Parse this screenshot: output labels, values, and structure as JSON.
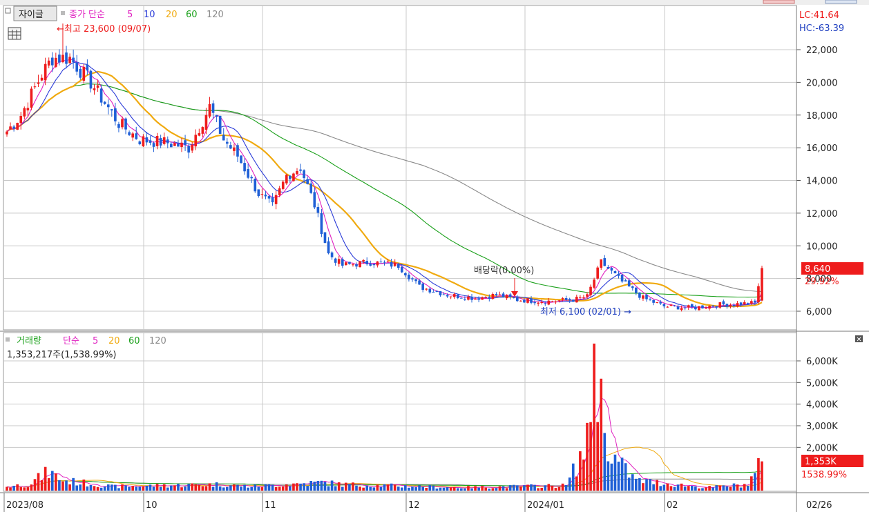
{
  "colors": {
    "up": "#ee1c1c",
    "down": "#1f5fd6",
    "ma5": "#e020c0",
    "ma10": "#2a3bd8",
    "ma20": "#f0aa10",
    "ma60": "#1aa01a",
    "ma120": "#8a8a8a",
    "grid": "#c8c8c8",
    "frame": "#9a9a9a",
    "text": "#222222"
  },
  "price_panel": {
    "button_label": "자이글",
    "legend": {
      "prefix": "종가 단순",
      "items": [
        {
          "label": "5",
          "color": "#e020c0"
        },
        {
          "label": "10",
          "color": "#2a3bd8"
        },
        {
          "label": "20",
          "color": "#f0aa10"
        },
        {
          "label": "60",
          "color": "#1aa01a"
        },
        {
          "label": "120",
          "color": "#8a8a8a"
        }
      ]
    },
    "high_marker": "←최고 23,600 (09/07)",
    "low_marker": "최저 6,100 (02/01) →",
    "dividend_marker": "배당락(0.00%)",
    "lc_text": "LC:41.64",
    "hc_text": "HC:-63.39",
    "last_price_tag": "8,640",
    "last_change_tag": "29.92%",
    "yticks": [
      "22,000",
      "20,000",
      "18,000",
      "16,000",
      "14,000",
      "12,000",
      "10,000",
      "8,000",
      "6,000"
    ],
    "icons": [
      "table-icon"
    ]
  },
  "volume_panel": {
    "legend": {
      "prefix": "거래량",
      "suffix": "단순",
      "items": [
        {
          "label": "5",
          "color": "#e020c0"
        },
        {
          "label": "20",
          "color": "#f0aa10"
        },
        {
          "label": "60",
          "color": "#1aa01a"
        },
        {
          "label": "120",
          "color": "#8a8a8a"
        }
      ]
    },
    "info_text": "1,353,217주(1,538.99%)",
    "last_volume_tag": "1,353K",
    "last_volume_pct_tag": "1538.99%",
    "yticks": [
      "6,000K",
      "5,000K",
      "4,000K",
      "3,000K",
      "2,000K"
    ],
    "icons": [
      "collapse-icon"
    ]
  },
  "xaxis": {
    "labels": [
      "2023/08",
      "10",
      "11",
      "12",
      "2024/01",
      "02",
      "02/26"
    ]
  },
  "chart_data": {
    "type": "candlestick",
    "x_range": [
      "2023/08",
      "2024/02/26"
    ],
    "price_ylim": [
      5000,
      24000
    ],
    "volume_ylim": [
      0,
      7000
    ],
    "x_tick_positions": [
      {
        "label": "2023/08",
        "index": 0
      },
      {
        "label": "10",
        "index": 40
      },
      {
        "label": "11",
        "index": 74
      },
      {
        "label": "12",
        "index": 115
      },
      {
        "label": "2024/01",
        "index": 149
      },
      {
        "label": "02",
        "index": 189
      }
    ],
    "high": {
      "price": 23600,
      "date": "09/07"
    },
    "low": {
      "price": 6100,
      "date": "02/01"
    },
    "last": {
      "price": 8640,
      "change_pct": 29.92,
      "volume_k": 1353
    },
    "anchors": [
      [
        0,
        17000
      ],
      [
        4,
        18000
      ],
      [
        10,
        20500
      ],
      [
        13,
        21500
      ],
      [
        18,
        21500
      ],
      [
        24,
        20000
      ],
      [
        32,
        17500
      ],
      [
        38,
        16500
      ],
      [
        46,
        16300
      ],
      [
        52,
        16000
      ],
      [
        58,
        18500
      ],
      [
        62,
        16500
      ],
      [
        66,
        15500
      ],
      [
        72,
        13200
      ],
      [
        76,
        12400
      ],
      [
        80,
        14300
      ],
      [
        84,
        14800
      ],
      [
        88,
        12500
      ],
      [
        92,
        9500
      ],
      [
        96,
        8800
      ],
      [
        104,
        9000
      ],
      [
        112,
        8800
      ],
      [
        118,
        7500
      ],
      [
        126,
        7000
      ],
      [
        134,
        6800
      ],
      [
        140,
        7000
      ],
      [
        146,
        6700
      ],
      [
        154,
        6600
      ],
      [
        162,
        6700
      ],
      [
        166,
        6900
      ],
      [
        170,
        9000
      ],
      [
        176,
        7800
      ],
      [
        182,
        6800
      ],
      [
        188,
        6300
      ],
      [
        196,
        6200
      ],
      [
        204,
        6400
      ],
      [
        214,
        6500
      ],
      [
        216,
        8640
      ]
    ],
    "volume_anchors": [
      [
        0,
        200
      ],
      [
        6,
        300
      ],
      [
        12,
        900
      ],
      [
        16,
        500
      ],
      [
        30,
        200
      ],
      [
        60,
        300
      ],
      [
        70,
        200
      ],
      [
        90,
        400
      ],
      [
        96,
        300
      ],
      [
        130,
        150
      ],
      [
        160,
        250
      ],
      [
        166,
        2300
      ],
      [
        168,
        6800
      ],
      [
        171,
        2900
      ],
      [
        174,
        1500
      ],
      [
        180,
        500
      ],
      [
        200,
        150
      ],
      [
        212,
        300
      ],
      [
        216,
        1353
      ]
    ],
    "ma_periods": [
      5,
      10,
      20,
      60,
      120
    ]
  }
}
